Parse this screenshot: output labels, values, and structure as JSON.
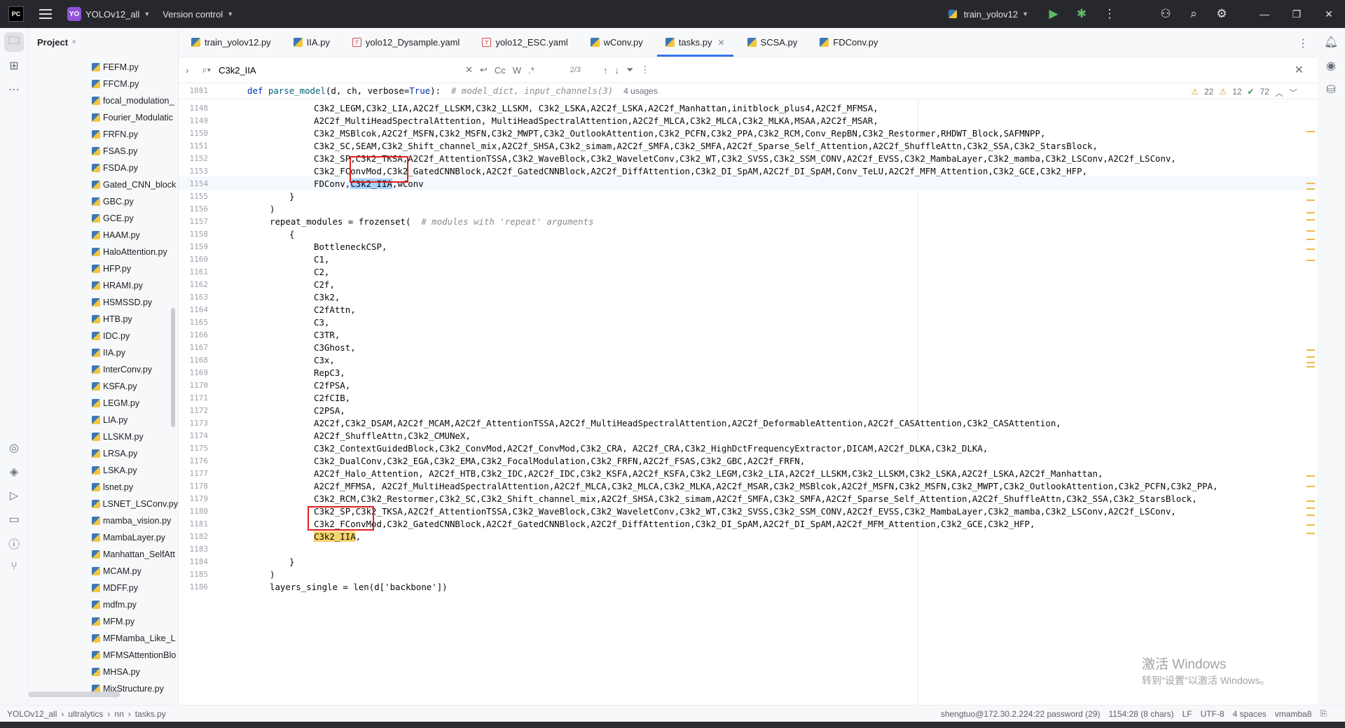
{
  "titlebar": {
    "app_logo": "PC",
    "project_badge": "YO",
    "project_name": "YOLOv12_all",
    "vcs_label": "Version control",
    "run_config": "train_yolov12"
  },
  "project_panel": {
    "title": "Project",
    "files": [
      "FEFM.py",
      "FFCM.py",
      "focal_modulation_",
      "Fourier_Modulatic",
      "FRFN.py",
      "FSAS.py",
      "FSDA.py",
      "Gated_CNN_block",
      "GBC.py",
      "GCE.py",
      "HAAM.py",
      "HaloAttention.py",
      "HFP.py",
      "HRAMI.py",
      "HSMSSD.py",
      "HTB.py",
      "IDC.py",
      "IIA.py",
      "InterConv.py",
      "KSFA.py",
      "LEGM.py",
      "LIA.py",
      "LLSKM.py",
      "LRSA.py",
      "LSKA.py",
      "lsnet.py",
      "LSNET_LSConv.py",
      "mamba_vision.py",
      "MambaLayer.py",
      "Manhattan_SelfAtt",
      "MCAM.py",
      "MDFF.py",
      "mdfm.py",
      "MFM.py",
      "MFMamba_Like_L",
      "MFMSAttentionBlo",
      "MHSA.py",
      "MixStructure.py"
    ]
  },
  "tabs": [
    {
      "label": "train_yolov12.py",
      "type": "py"
    },
    {
      "label": "IIA.py",
      "type": "py"
    },
    {
      "label": "yolo12_Dysample.yaml",
      "type": "yaml"
    },
    {
      "label": "yolo12_ESC.yaml",
      "type": "yaml"
    },
    {
      "label": "wConv.py",
      "type": "py"
    },
    {
      "label": "tasks.py",
      "type": "py",
      "active": true
    },
    {
      "label": "SCSA.py",
      "type": "py"
    },
    {
      "label": "FDConv.py",
      "type": "py"
    }
  ],
  "find": {
    "query": "C3k2_IIA",
    "match_case": "Cc",
    "words": "W",
    "regex": ".*",
    "count": "2/3"
  },
  "inspections": {
    "warnings": "22",
    "weak_warnings": "12",
    "ok": "72"
  },
  "sticky": {
    "line": "1081",
    "def_kw": "def",
    "fn_name": "parse_model",
    "params": "(d, ch, verbose=",
    "true_kw": "True",
    "params_end": "):",
    "comment": "# model_dict, input_channels(3)",
    "usages": "4 usages"
  },
  "code_lines": [
    {
      "n": "1148",
      "t": "C3k2_LEGM,C3k2_LIA,A2C2f_LLSKM,C3k2_LLSKM, C3k2_LSKA,A2C2f_LSKA,A2C2f_Manhattan,initblock_plus4,A2C2f_MFMSA,"
    },
    {
      "n": "1149",
      "t": "A2C2f_MultiHeadSpectralAttention, MultiHeadSpectralAttention,A2C2f_MLCA,C3k2_MLCA,C3k2_MLKA,MSAA,A2C2f_MSAR,"
    },
    {
      "n": "1150",
      "t": "C3k2_MSBlcok,A2C2f_MSFN,C3k2_MSFN,C3k2_MWPT,C3k2_OutlookAttention,C3k2_PCFN,C3k2_PPA,C3k2_RCM,Conv_RepBN,C3k2_Restormer,RHDWT_Block,SAFMNPP,"
    },
    {
      "n": "1151",
      "t": "C3k2_SC,SEAM,C3k2_Shift_channel_mix,A2C2f_SHSA,C3k2_simam,A2C2f_SMFA,C3k2_SMFA,A2C2f_Sparse_Self_Attention,A2C2f_ShuffleAttn,C3k2_SSA,C3k2_StarsBlock,"
    },
    {
      "n": "1152",
      "t": "C3k2_SP,C3k2_TKSA,A2C2f_AttentionTSSA,C3k2_WaveBlock,C3k2_WaveletConv,C3k2_WT,C3k2_SVSS,C3k2_SSM_CONV,A2C2f_EVSS,C3k2_MambaLayer,C3k2_mamba,C3k2_LSConv,A2C2f_LSConv,"
    },
    {
      "n": "1153",
      "t": "C3k2_FConvMod,C3k2_GatedCNNBlock,A2C2f_GatedCNNBlock,A2C2f_DiffAttention,C3k2_DI_SpAM,A2C2f_DI_SpAM,Conv_TeLU,A2C2f_MFM_Attention,C3k2_GCE,C3k2_HFP,"
    },
    {
      "n": "1154",
      "pre": "FDConv,",
      "hl": "C3k2_IIA",
      "post": ",wConv",
      "current": true
    },
    {
      "n": "1155",
      "t": "}",
      "indent": "b"
    },
    {
      "n": "1156",
      "t": ")",
      "indent": "a"
    },
    {
      "n": "1157",
      "t": "repeat_modules = frozenset(",
      "cmt": "# modules with 'repeat' arguments",
      "indent": "a"
    },
    {
      "n": "1158",
      "t": "{",
      "indent": "b"
    },
    {
      "n": "1159",
      "t": "BottleneckCSP,"
    },
    {
      "n": "1160",
      "t": "C1,"
    },
    {
      "n": "1161",
      "t": "C2,"
    },
    {
      "n": "1162",
      "t": "C2f,"
    },
    {
      "n": "1163",
      "t": "C3k2,"
    },
    {
      "n": "1164",
      "t": "C2fAttn,"
    },
    {
      "n": "1165",
      "t": "C3,"
    },
    {
      "n": "1166",
      "t": "C3TR,"
    },
    {
      "n": "1167",
      "t": "C3Ghost,"
    },
    {
      "n": "1168",
      "t": "C3x,"
    },
    {
      "n": "1169",
      "t": "RepC3,"
    },
    {
      "n": "1170",
      "t": "C2fPSA,"
    },
    {
      "n": "1171",
      "t": "C2fCIB,"
    },
    {
      "n": "1172",
      "t": "C2PSA,"
    },
    {
      "n": "1173",
      "t": "A2C2f,C3k2_DSAM,A2C2f_MCAM,A2C2f_AttentionTSSA,A2C2f_MultiHeadSpectralAttention,A2C2f_DeformableAttention,A2C2f_CASAttention,C3k2_CASAttention,"
    },
    {
      "n": "1174",
      "t": "A2C2f_ShuffleAttn,C3k2_CMUNeX,"
    },
    {
      "n": "1175",
      "t": "C3k2_ContextGuidedBlock,C3k2_ConvMod,A2C2f_ConvMod,C3k2_CRA, A2C2f_CRA,C3k2_HighDctFrequencyExtractor,DICAM,A2C2f_DLKA,C3k2_DLKA,"
    },
    {
      "n": "1176",
      "t": "C3k2_DualConv,C3k2_EGA,C3k2_EMA,C3k2_FocalModulation,C3k2_FRFN,A2C2f_FSAS,C3k2_GBC,A2C2f_FRFN,"
    },
    {
      "n": "1177",
      "t": "A2C2f_Halo_Attention, A2C2f_HTB,C3k2_IDC,A2C2f_IDC,C3k2_KSFA,A2C2f_KSFA,C3k2_LEGM,C3k2_LIA,A2C2f_LLSKM,C3k2_LLSKM,C3k2_LSKA,A2C2f_LSKA,A2C2f_Manhattan,"
    },
    {
      "n": "1178",
      "t": "A2C2f_MFMSA, A2C2f_MultiHeadSpectralAttention,A2C2f_MLCA,C3k2_MLCA,C3k2_MLKA,A2C2f_MSAR,C3k2_MSBlcok,A2C2f_MSFN,C3k2_MSFN,C3k2_MWPT,C3k2_OutlookAttention,C3k2_PCFN,C3k2_PPA,"
    },
    {
      "n": "1179",
      "t": "C3k2_RCM,C3k2_Restormer,C3k2_SC,C3k2_Shift_channel_mix,A2C2f_SHSA,C3k2_simam,A2C2f_SMFA,C3k2_SMFA,A2C2f_Sparse_Self_Attention,A2C2f_ShuffleAttn,C3k2_SSA,C3k2_StarsBlock,"
    },
    {
      "n": "1180",
      "t": "C3k2_SP,C3k2_TKSA,A2C2f_AttentionTSSA,C3k2_WaveBlock,C3k2_WaveletConv,C3k2_WT,C3k2_SVSS,C3k2_SSM_CONV,A2C2f_EVSS,C3k2_MambaLayer,C3k2_mamba,C3k2_LSConv,A2C2f_LSConv,"
    },
    {
      "n": "1181",
      "t": "C3k2_FConvMod,C3k2_GatedCNNBlock,A2C2f_GatedCNNBlock,A2C2f_DiffAttention,C3k2_DI_SpAM,A2C2f_DI_SpAM,A2C2f_MFM_Attention,C3k2_GCE,C3k2_HFP,"
    },
    {
      "n": "1182",
      "hl2": "C3k2_IIA",
      "post": ","
    },
    {
      "n": "1183",
      "t": ""
    },
    {
      "n": "1184",
      "t": "}",
      "indent": "b"
    },
    {
      "n": "1185",
      "t": ")",
      "indent": "a"
    },
    {
      "n": "1186",
      "t": "layers_single = len(d['backbone'])",
      "indent": "a"
    }
  ],
  "watermark": {
    "line1": "激活 Windows",
    "line2": "转到\"设置\"以激活 Windows。"
  },
  "statusbar": {
    "breadcrumb": [
      "YOLOv12_all",
      "ultralytics",
      "nn",
      "tasks.py"
    ],
    "remote": "shengtuo@172.30.2.224:22 password (29)",
    "position": "1154:28 (8 chars)",
    "line_sep": "LF",
    "encoding": "UTF-8",
    "indent": "4 spaces",
    "interpreter": "vmamba8"
  },
  "colors": {
    "accent": "#3574f0",
    "find_highlight": "#f5d56c",
    "selection": "#a6d2ff",
    "red_box": "#e02020"
  }
}
